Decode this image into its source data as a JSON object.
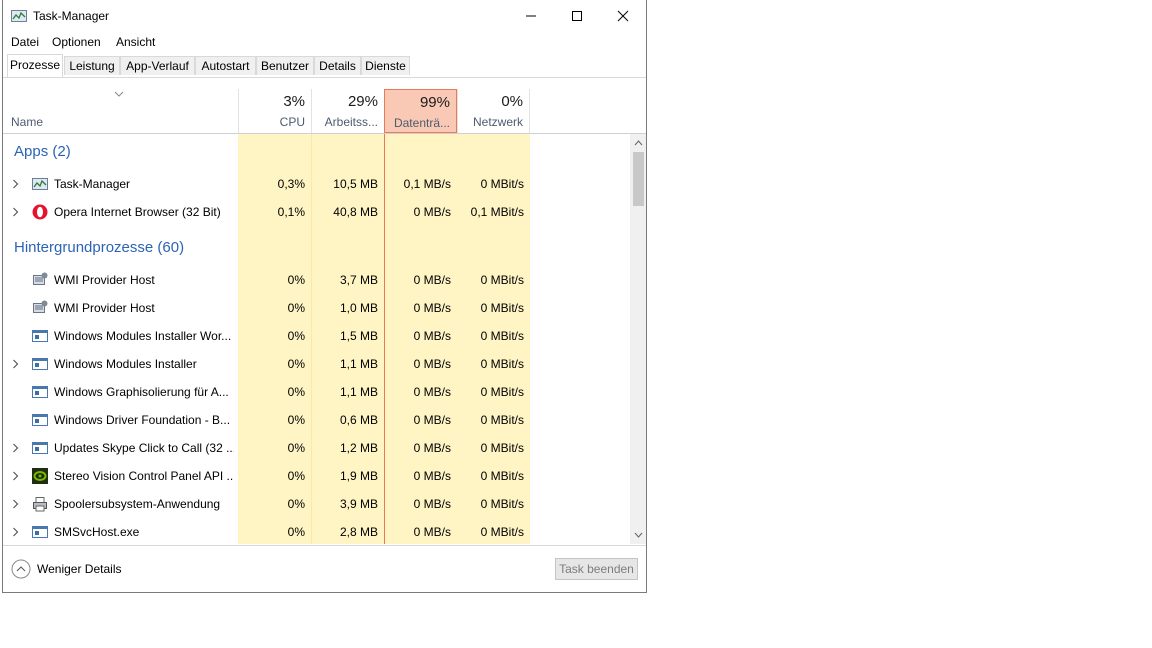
{
  "window": {
    "title": "Task-Manager"
  },
  "menu": [
    "Datei",
    "Optionen",
    "Ansicht"
  ],
  "tabs": [
    "Prozesse",
    "Leistung",
    "App-Verlauf",
    "Autostart",
    "Benutzer",
    "Details",
    "Dienste"
  ],
  "active_tab": "Prozesse",
  "columns": {
    "name": "Name",
    "cpu": {
      "pct": "3%",
      "label": "CPU"
    },
    "mem": {
      "pct": "29%",
      "label": "Arbeitss..."
    },
    "disk": {
      "pct": "99%",
      "label": "Datenträ..."
    },
    "net": {
      "pct": "0%",
      "label": "Netzwerk"
    }
  },
  "groups": {
    "apps": "Apps (2)",
    "background": "Hintergrundprozesse (60)"
  },
  "apps": [
    {
      "name": "Task-Manager",
      "cpu": "0,3%",
      "mem": "10,5 MB",
      "disk": "0,1 MB/s",
      "net": "0 MBit/s",
      "icon": "task-manager-icon"
    },
    {
      "name": "Opera Internet Browser (32 Bit)",
      "cpu": "0,1%",
      "mem": "40,8 MB",
      "disk": "0 MB/s",
      "net": "0,1 MBit/s",
      "icon": "opera-icon"
    }
  ],
  "background": [
    {
      "name": "WMI Provider Host",
      "cpu": "0%",
      "mem": "3,7 MB",
      "disk": "0 MB/s",
      "net": "0 MBit/s",
      "icon": "wmi-icon"
    },
    {
      "name": "WMI Provider Host",
      "cpu": "0%",
      "mem": "1,0 MB",
      "disk": "0 MB/s",
      "net": "0 MBit/s",
      "icon": "wmi-icon"
    },
    {
      "name": "Windows Modules Installer Wor...",
      "cpu": "0%",
      "mem": "1,5 MB",
      "disk": "0 MB/s",
      "net": "0 MBit/s",
      "icon": "window-icon"
    },
    {
      "name": "Windows Modules Installer",
      "cpu": "0%",
      "mem": "1,1 MB",
      "disk": "0 MB/s",
      "net": "0 MBit/s",
      "icon": "window-icon"
    },
    {
      "name": "Windows Graphisolierung für A...",
      "cpu": "0%",
      "mem": "1,1 MB",
      "disk": "0 MB/s",
      "net": "0 MBit/s",
      "icon": "window-icon"
    },
    {
      "name": "Windows Driver Foundation - B...",
      "cpu": "0%",
      "mem": "0,6 MB",
      "disk": "0 MB/s",
      "net": "0 MBit/s",
      "icon": "window-icon"
    },
    {
      "name": "Updates Skype Click to Call (32 ...",
      "cpu": "0%",
      "mem": "1,2 MB",
      "disk": "0 MB/s",
      "net": "0 MBit/s",
      "icon": "window-icon"
    },
    {
      "name": "Stereo Vision Control Panel API ...",
      "cpu": "0%",
      "mem": "1,9 MB",
      "disk": "0 MB/s",
      "net": "0 MBit/s",
      "icon": "nvidia-icon"
    },
    {
      "name": "Spoolersubsystem-Anwendung",
      "cpu": "0%",
      "mem": "3,9 MB",
      "disk": "0 MB/s",
      "net": "0 MBit/s",
      "icon": "printer-icon"
    },
    {
      "name": "SMSvcHost.exe",
      "cpu": "0%",
      "mem": "2,8 MB",
      "disk": "0 MB/s",
      "net": "0 MBit/s",
      "icon": "window-icon"
    }
  ],
  "footer": {
    "fewer_details": "Weniger Details",
    "end_task": "Task beenden"
  }
}
